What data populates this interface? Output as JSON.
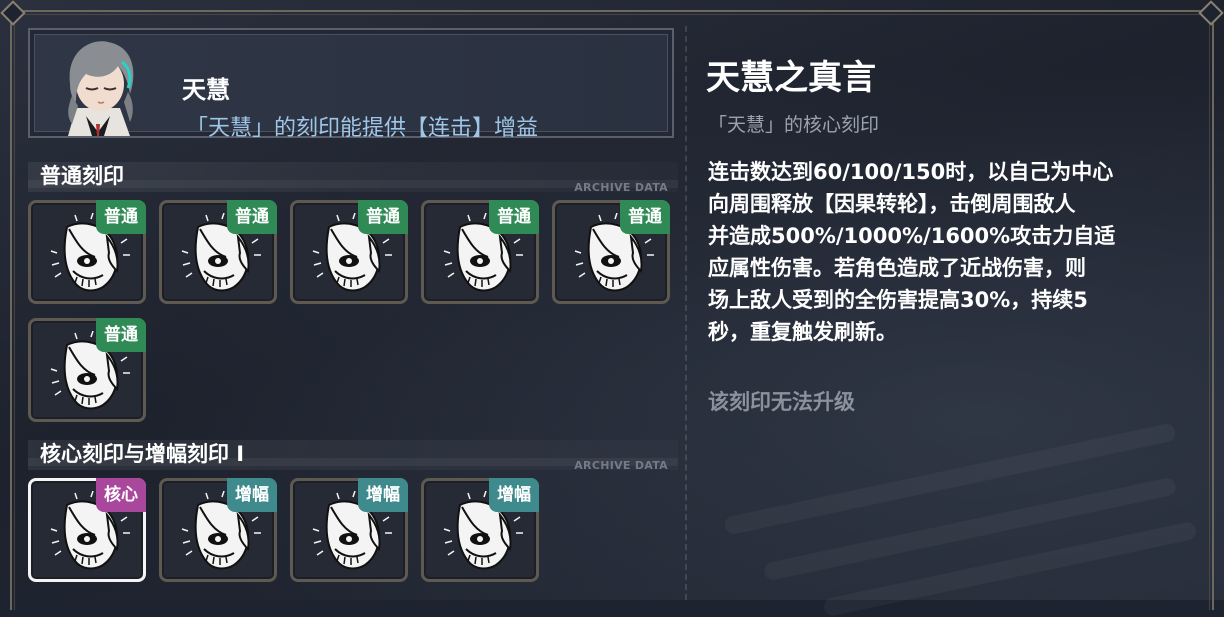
{
  "character": {
    "name": "天慧",
    "description": "「天慧」的刻印能提供【连击】增益"
  },
  "sections": {
    "normal": {
      "label": "普通刻印",
      "tag": "ARCHIVE DATA"
    },
    "core": {
      "label": "核心刻印与增幅刻印 I",
      "tag": "ARCHIVE DATA"
    }
  },
  "normal_imprints": [
    {
      "badge": "普通",
      "icon": "mask-icon"
    },
    {
      "badge": "普通",
      "icon": "mask-icon"
    },
    {
      "badge": "普通",
      "icon": "mask-icon"
    },
    {
      "badge": "普通",
      "icon": "mask-icon"
    },
    {
      "badge": "普通",
      "icon": "mask-icon"
    },
    {
      "badge": "普通",
      "icon": "mask-icon"
    }
  ],
  "core_imprints": [
    {
      "badge": "核心",
      "icon": "mask-icon",
      "selected": true
    },
    {
      "badge": "增幅",
      "icon": "mask-icon"
    },
    {
      "badge": "增幅",
      "icon": "mask-icon"
    },
    {
      "badge": "增幅",
      "icon": "mask-icon"
    }
  ],
  "detail": {
    "title": "天慧之真言",
    "subtitle": "「天慧」的核心刻印",
    "lines": [
      "连击数达到60/100/150时，以自己为中心",
      "向周围释放【因果转轮】，击倒周围敌人",
      "并造成500%/1000%/1600%攻击力自适",
      "应属性伤害。若角色造成了近战伤害，则",
      "场上敌人受到的全伤害提高30%，持续5",
      "秒，重复触发刷新。"
    ],
    "note": "该刻印无法升级"
  },
  "colors": {
    "badge_normal": "#2f8a55",
    "badge_amp": "#3f8a8c",
    "badge_core": "#a9479c",
    "accent_text": "#9fc6e6"
  }
}
